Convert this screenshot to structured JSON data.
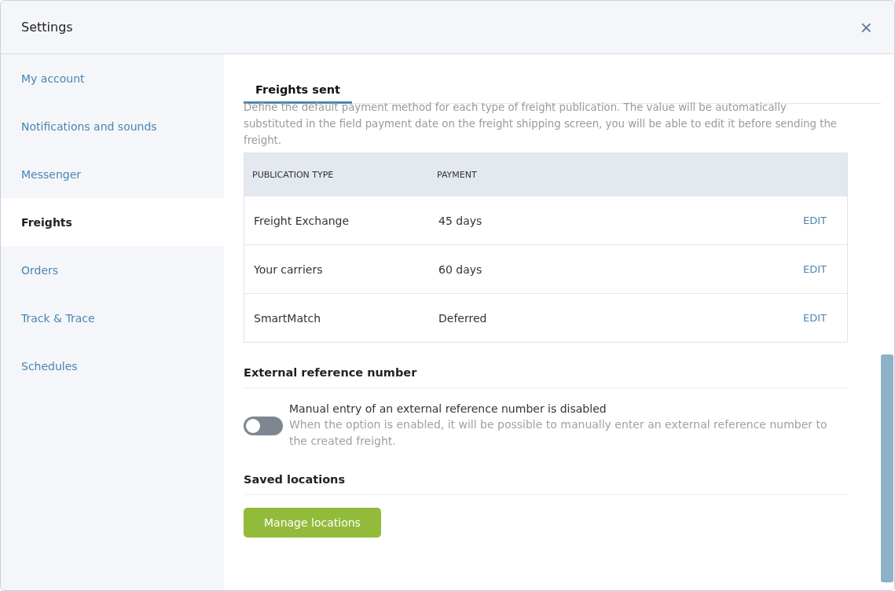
{
  "window": {
    "title": "Settings",
    "close": "×"
  },
  "sidebar": {
    "items": [
      {
        "label": "My account",
        "selected": false
      },
      {
        "label": "Notifications and sounds",
        "selected": false
      },
      {
        "label": "Messenger",
        "selected": false
      },
      {
        "label": "Freights",
        "selected": true
      },
      {
        "label": "Orders",
        "selected": false
      },
      {
        "label": "Track & Trace",
        "selected": false
      },
      {
        "label": "Schedules",
        "selected": false
      }
    ]
  },
  "tabs": [
    {
      "label": "Freights sent",
      "selected": true
    }
  ],
  "description": "Define the default payment method for each type of freight publication. The value will be automatically substituted in the field payment date on the freight shipping screen, you will be able to edit it before sending the freight.",
  "table": {
    "columns": [
      "PUBLICATION TYPE",
      "PAYMENT"
    ],
    "rows": [
      {
        "type": "Freight Exchange",
        "payment": "45 days",
        "action": "EDIT"
      },
      {
        "type": "Your carriers",
        "payment": "60 days",
        "action": "EDIT"
      },
      {
        "type": "SmartMatch",
        "payment": "Deferred",
        "action": "EDIT"
      }
    ]
  },
  "external_reference": {
    "title": "External reference number",
    "toggle": {
      "on": false,
      "label": "Manual entry of an external reference number is disabled",
      "hint": "When the option is enabled, it will be possible to manually enter an external reference number to the created freight."
    }
  },
  "saved_locations": {
    "title": "Saved locations",
    "button": "Manage locations"
  }
}
